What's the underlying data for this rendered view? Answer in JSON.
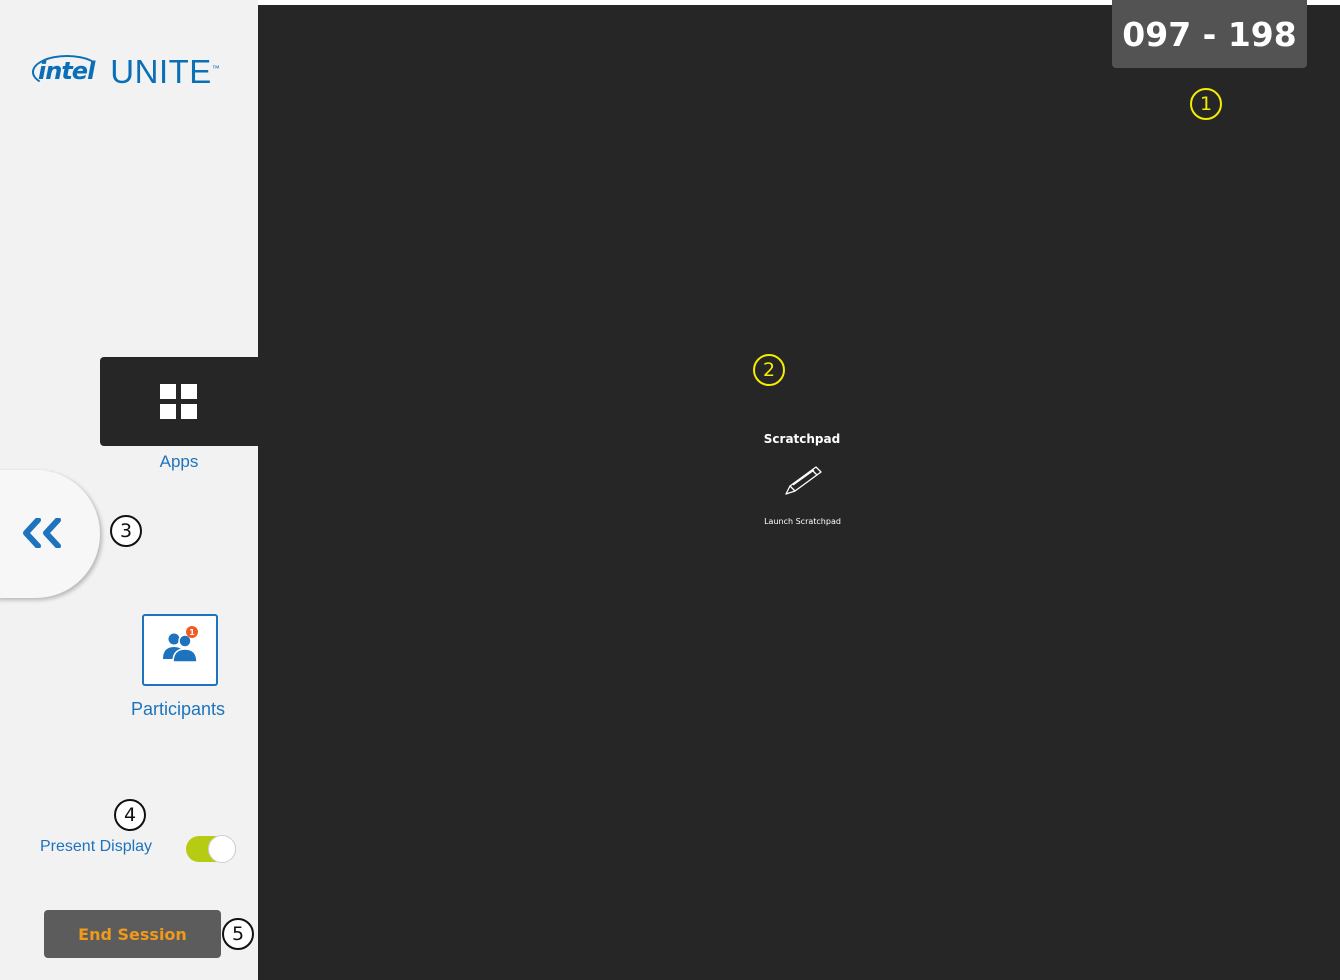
{
  "sidebar": {
    "logo": {
      "brand": "intel",
      "product": "UNITE"
    },
    "apps": {
      "label": "Apps",
      "icon": "grid-icon"
    },
    "collapse": {
      "icon": "double-chevron-left-icon"
    },
    "participants": {
      "label": "Participants",
      "icon": "people-icon",
      "badge": "1"
    },
    "present_display": {
      "label": "Present Display",
      "enabled": true
    },
    "end_session": {
      "label": "End Session"
    }
  },
  "main": {
    "pin": "097 - 198",
    "app_tile": {
      "title": "Scratchpad",
      "icon": "pencil-icon",
      "action": "Launch Scratchpad"
    }
  },
  "markers": [
    "1",
    "2",
    "3",
    "4",
    "5"
  ],
  "colors": {
    "accent": "#1e73be",
    "sidebar_bg": "#f2f2f2",
    "main_bg": "#262626",
    "toggle_on": "#b6cc13",
    "end_session_text": "#f09a1c",
    "badge": "#f15a24",
    "marker_yellow": "#f6ec00"
  }
}
